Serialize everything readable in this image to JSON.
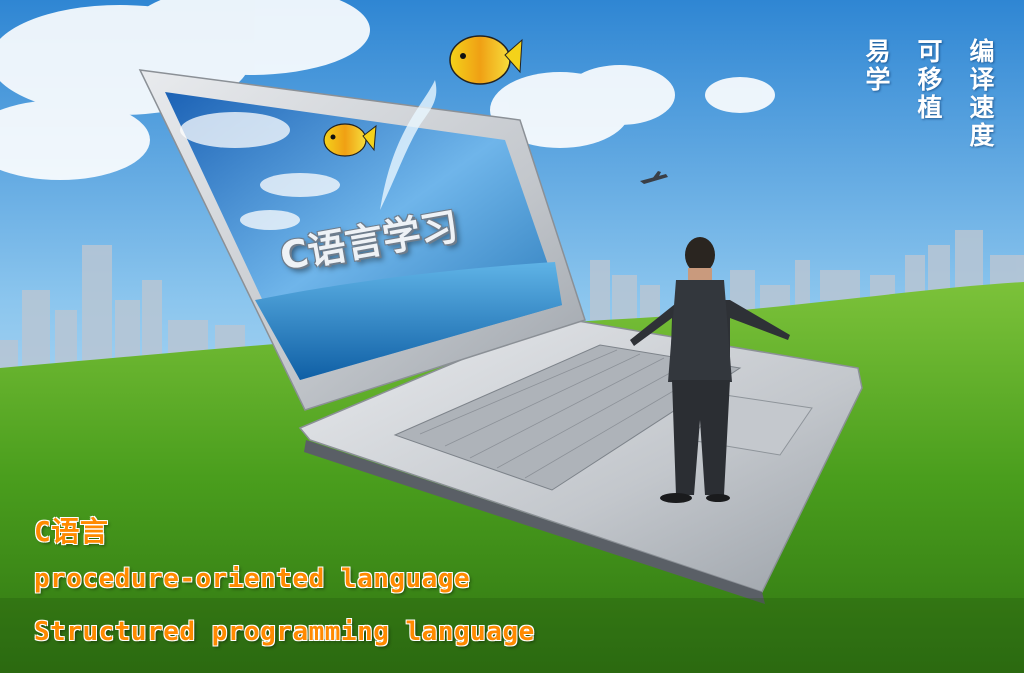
{
  "slogans": {
    "col1": "编译速度",
    "col2": "可移植",
    "col3": "易学"
  },
  "screen_title": "C语言学习",
  "captions": {
    "title": "C语言",
    "line1": "procedure-oriented language",
    "line2": "Structured programming language"
  },
  "colors": {
    "sky_top": "#2f86d3",
    "grass": "#4a9e1d",
    "caption_orange": "#ff8a00",
    "laptop_silver": "#c9ccd0"
  }
}
